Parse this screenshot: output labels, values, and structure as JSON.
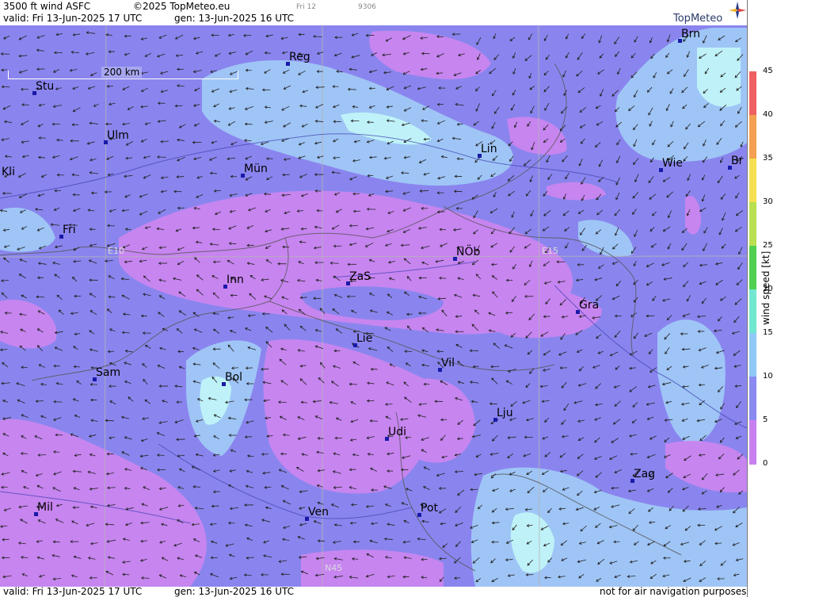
{
  "header": {
    "title": "3500 ft wind ASFC",
    "copyright": "©2025 TopMeteo.eu",
    "day": "Fri 12",
    "code": "9306",
    "valid": "valid:  Fri  13-Jun-2025  17 UTC",
    "gen": "gen: 13-Jun-2025 16 UTC",
    "brand": "TopMeteo"
  },
  "footer": {
    "valid": "valid:  Fri  13-Jun-2025  17 UTC",
    "gen": "gen: 13-Jun-2025 16 UTC",
    "note": "not for air navigation purposes"
  },
  "scale_bar": {
    "label": "200 km"
  },
  "grid_labels": {
    "lon_e10": "E10",
    "lon_e15": "E15",
    "lat_n45": "N45"
  },
  "legend": {
    "unit": "wind  speed  [kt]",
    "ticks": [
      "45",
      "40",
      "35",
      "30",
      "25",
      "20",
      "15",
      "10",
      "5",
      "0"
    ],
    "colors": [
      "#f06060",
      "#f4a050",
      "#f4e050",
      "#b8e050",
      "#50d050",
      "#70e8d0",
      "#90c8f8",
      "#8a8af0",
      "#c880f0"
    ]
  },
  "cities": [
    {
      "name": "Stu"
    },
    {
      "name": "Reg"
    },
    {
      "name": "Brn"
    },
    {
      "name": "Ulm"
    },
    {
      "name": "Lin"
    },
    {
      "name": "Kli"
    },
    {
      "name": "Mün"
    },
    {
      "name": "Wie"
    },
    {
      "name": "Br"
    },
    {
      "name": "Fri"
    },
    {
      "name": "NÖb"
    },
    {
      "name": "Inn"
    },
    {
      "name": "ZaS"
    },
    {
      "name": "Gra"
    },
    {
      "name": "Lie"
    },
    {
      "name": "Vil"
    },
    {
      "name": "Sam"
    },
    {
      "name": "Bol"
    },
    {
      "name": "Lju"
    },
    {
      "name": "Udi"
    },
    {
      "name": "Zag"
    },
    {
      "name": "Mil"
    },
    {
      "name": "Ven"
    },
    {
      "name": "Pot"
    }
  ]
}
